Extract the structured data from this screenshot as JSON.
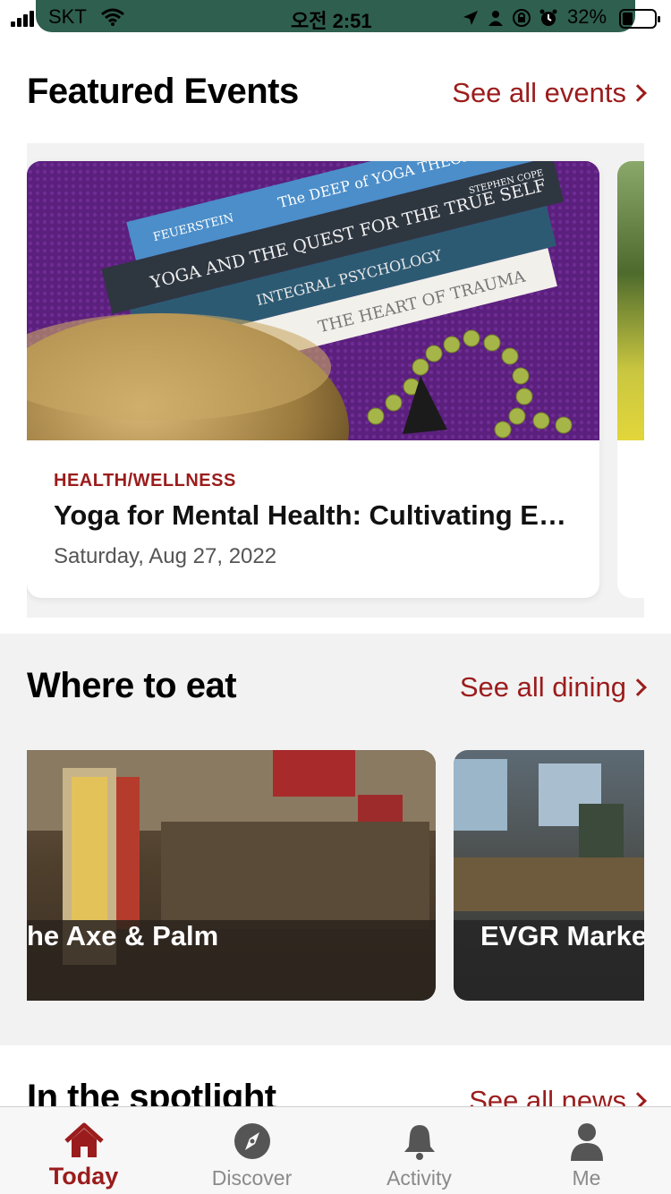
{
  "status_bar": {
    "carrier": "SKT",
    "time": "오전 2:51",
    "battery_percent": "32%",
    "battery_level": 0.32,
    "icons": [
      "signal-icon",
      "wifi-icon",
      "location-icon",
      "person-icon",
      "rotation-lock-icon",
      "alarm-icon",
      "battery-icon"
    ]
  },
  "featured_events": {
    "title": "Featured Events",
    "see_all": "See all events",
    "cards": [
      {
        "category": "HEALTH/WELLNESS",
        "title": "Yoga for Mental Health: Cultivating E…",
        "date": "Saturday, Aug 27, 2022",
        "book_titles": [
          "FEUERSTEIN",
          "The DEEP of YOGA THEORY AND PRACTICE",
          "YOGA AND THE QUEST FOR THE TRUE SELF",
          "STEPHEN COPE",
          "INTEGRAL PSYCHOLOGY",
          "THE HEART OF TRAUMA"
        ]
      }
    ]
  },
  "where_to_eat": {
    "title": "Where to eat",
    "see_all": "See all dining",
    "cards": [
      {
        "name": "he Axe & Palm"
      },
      {
        "name": "EVGR Market"
      }
    ]
  },
  "spotlight": {
    "title": "In the spotlight",
    "see_all": "See all news"
  },
  "tabbar": {
    "tabs": [
      {
        "label": "Today",
        "icon": "home-icon",
        "active": true
      },
      {
        "label": "Discover",
        "icon": "compass-icon",
        "active": false
      },
      {
        "label": "Activity",
        "icon": "bell-icon",
        "active": false
      },
      {
        "label": "Me",
        "icon": "person-icon",
        "active": false
      }
    ]
  },
  "colors": {
    "accent": "#9b1c1c",
    "band_background": "#f2f2f2",
    "status_pill": "#2f5f4f"
  }
}
